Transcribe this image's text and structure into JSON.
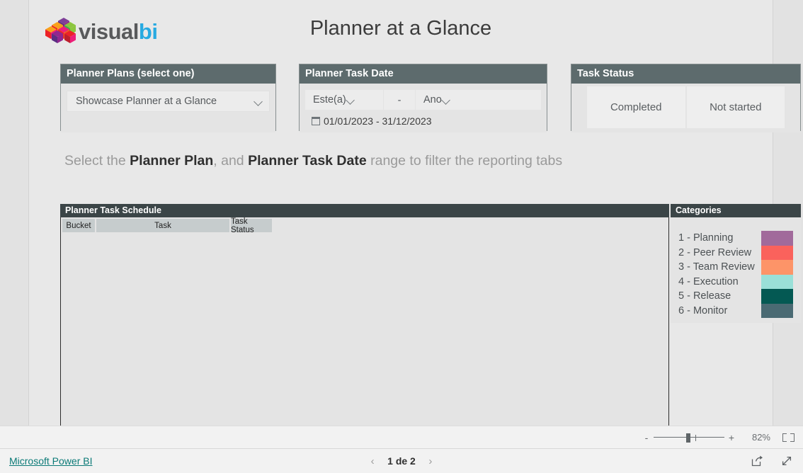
{
  "brand": {
    "logo_text_primary": "visual",
    "logo_text_secondary": "bi",
    "logo_icon": "visualbi-cube-logo"
  },
  "header": {
    "title": "Planner at a Glance"
  },
  "slicers": {
    "plans": {
      "title": "Planner Plans (select one)",
      "selected": "Showcase Planner at a Glance",
      "chevron_icon": "chevron-down-icon"
    },
    "date": {
      "title": "Planner Task Date",
      "relative": "Este(a)",
      "separator": "-",
      "unit": "Ano",
      "range": "01/01/2023 - 31/12/2023",
      "calendar_icon": "calendar-icon"
    },
    "status": {
      "title": "Task Status",
      "options": [
        "Completed",
        "Not started"
      ]
    }
  },
  "instruction": {
    "part1": "Select the ",
    "bold1": "Planner Plan",
    "part2": ", and ",
    "bold2": "Planner Task Date",
    "part3": " range to filter the reporting tabs"
  },
  "schedule": {
    "title": "Planner Task Schedule",
    "columns": [
      "Bucket",
      "Task",
      "Task Status"
    ],
    "rows": []
  },
  "categories": {
    "title": "Categories",
    "items": [
      {
        "label": "1 - Planning",
        "color": "#a16a9b"
      },
      {
        "label": "2 - Peer Review",
        "color": "#fa625c"
      },
      {
        "label": "3 - Team Review",
        "color": "#fd9468"
      },
      {
        "label": "4 - Execution",
        "color": "#9ae0d8"
      },
      {
        "label": "5 - Release",
        "color": "#045953"
      },
      {
        "label": "6 - Monitor",
        "color": "#4a6a73"
      }
    ]
  },
  "zoombar": {
    "minus": "-",
    "plus": "+",
    "percent": "82%",
    "fit_icon": "fit-to-page-icon"
  },
  "footer": {
    "link": "Microsoft Power BI",
    "prev_icon": "chevron-left-icon",
    "page_label": "1 de 2",
    "next_icon": "chevron-right-icon",
    "share_icon": "share-icon",
    "fullscreen_icon": "fullscreen-icon"
  }
}
